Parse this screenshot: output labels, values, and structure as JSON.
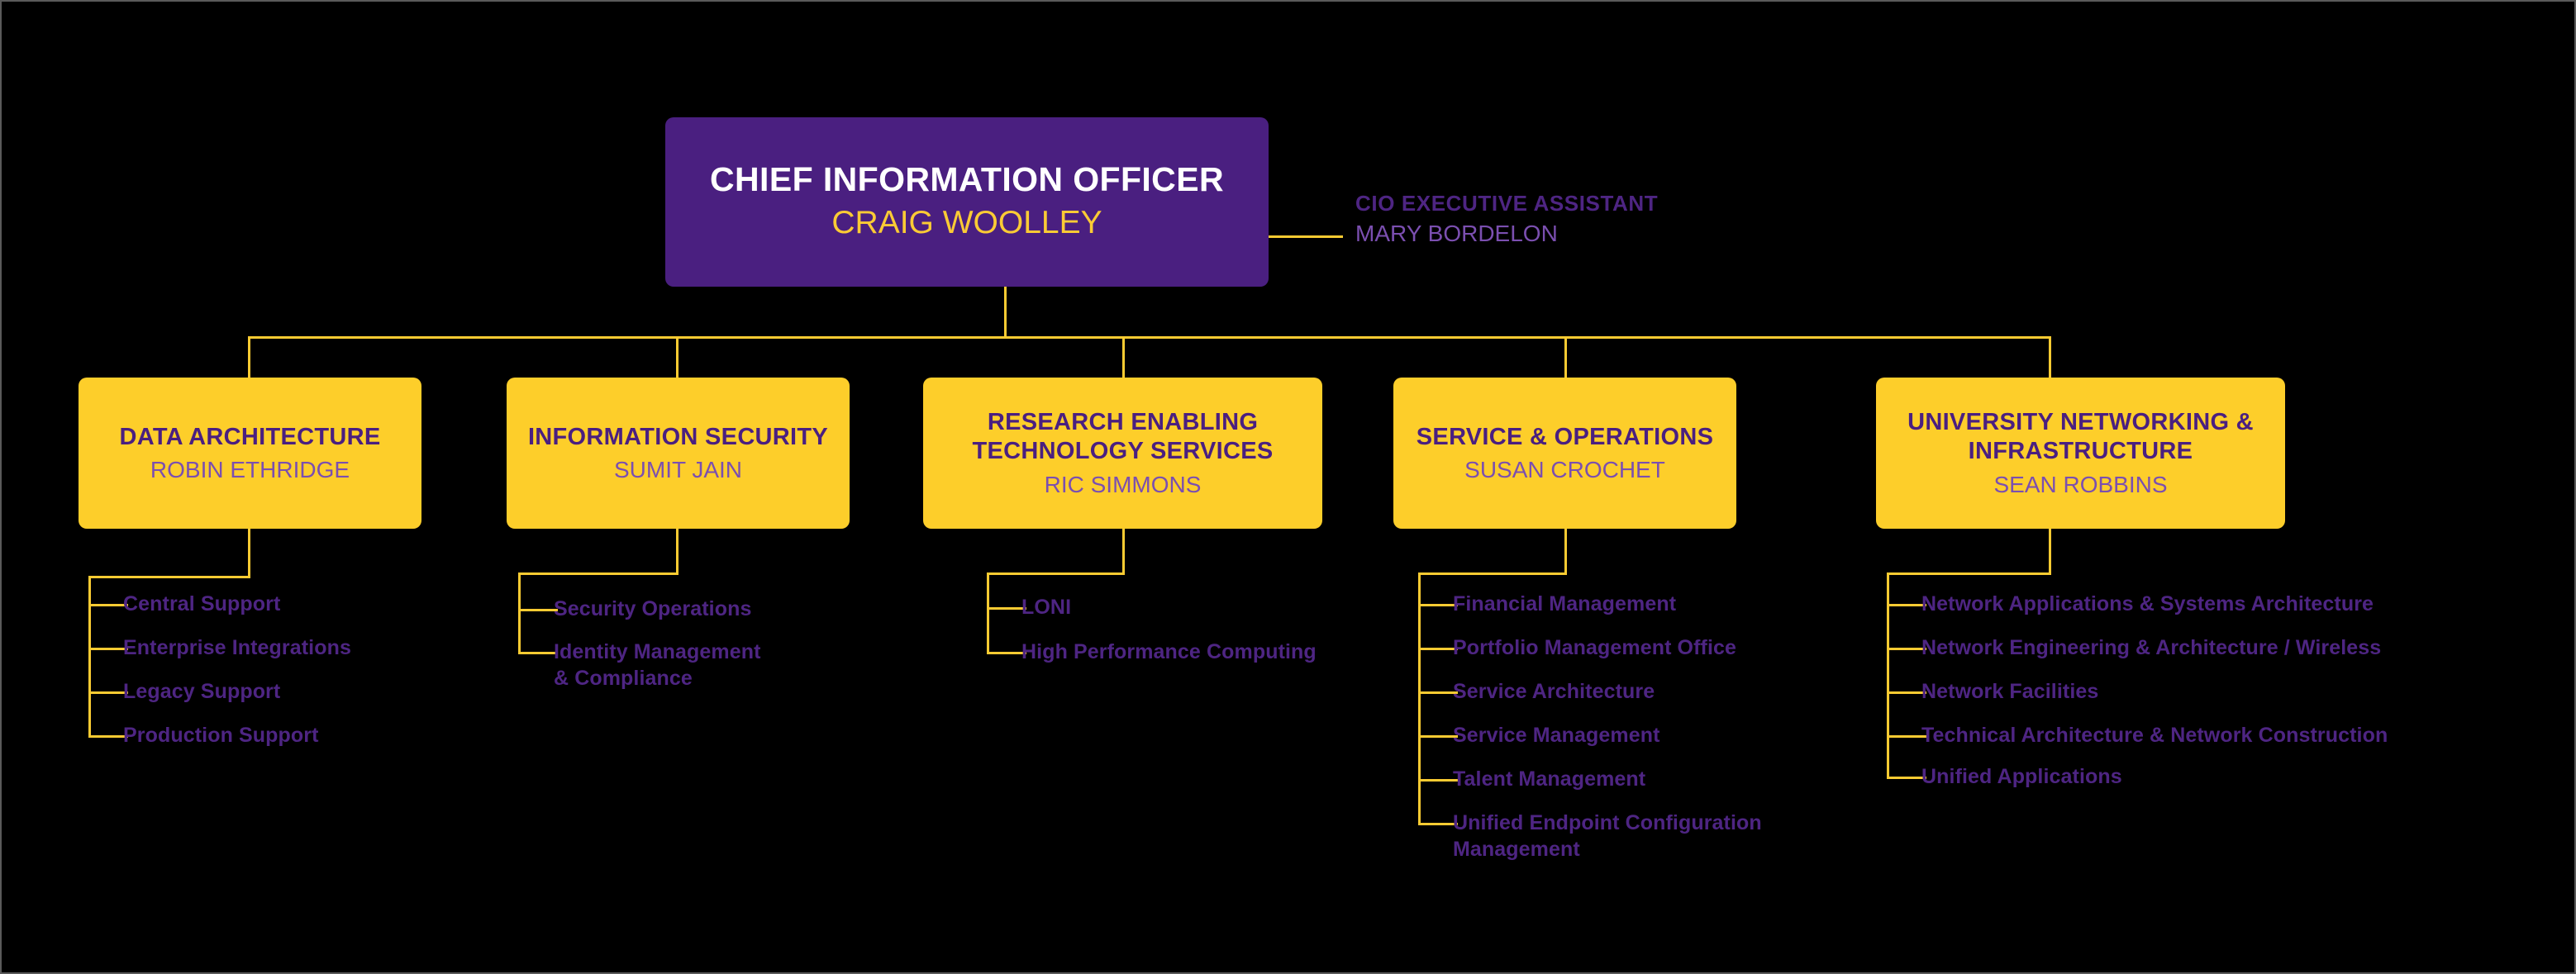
{
  "theme": {
    "background": "#000000",
    "accent_yellow": "#FDCE2A",
    "accent_purple": "#4A1F80",
    "line_color": "#FACB32",
    "name_purple": "#7B4FB0",
    "sub_item_purple": "#4E2583",
    "title_white": "#FFFFFF",
    "cio_name_gold": "#FBCB35"
  },
  "chart_data": {
    "type": "org-chart",
    "root": {
      "title": "CHIEF INFORMATION OFFICER",
      "name": "CRAIG WOOLLEY"
    },
    "assistant": {
      "title": "CIO EXECUTIVE ASSISTANT",
      "name": "MARY BORDELON"
    },
    "divisions": [
      {
        "title": "DATA\nARCHITECTURE",
        "name": "ROBIN ETHRIDGE",
        "items": [
          "Central Support",
          "Enterprise Integrations",
          "Legacy Support",
          "Production Support"
        ]
      },
      {
        "title": "INFORMATION\nSECURITY",
        "name": "SUMIT JAIN",
        "items": [
          "Security Operations",
          "Identity Management\n& Compliance"
        ]
      },
      {
        "title": "RESEARCH ENABLING\nTECHNOLOGY SERVICES",
        "name": "RIC SIMMONS",
        "items": [
          "LONI",
          "High Performance Computing"
        ]
      },
      {
        "title": "SERVICE &\nOPERATIONS",
        "name": "SUSAN CROCHET",
        "items": [
          "Financial Management",
          "Portfolio Management Office",
          "Service Architecture",
          "Service Management",
          "Talent Management",
          "Unified Endpoint Configuration\nManagement"
        ]
      },
      {
        "title": "UNIVERSITY NETWORKING\n& INFRASTRUCTURE",
        "name": "SEAN ROBBINS",
        "items": [
          "Network Applications & Systems Architecture",
          "Network Engineering & Architecture / Wireless",
          "Network Facilities",
          "Technical Architecture & Network Construction",
          "Unified Applications"
        ]
      }
    ]
  }
}
